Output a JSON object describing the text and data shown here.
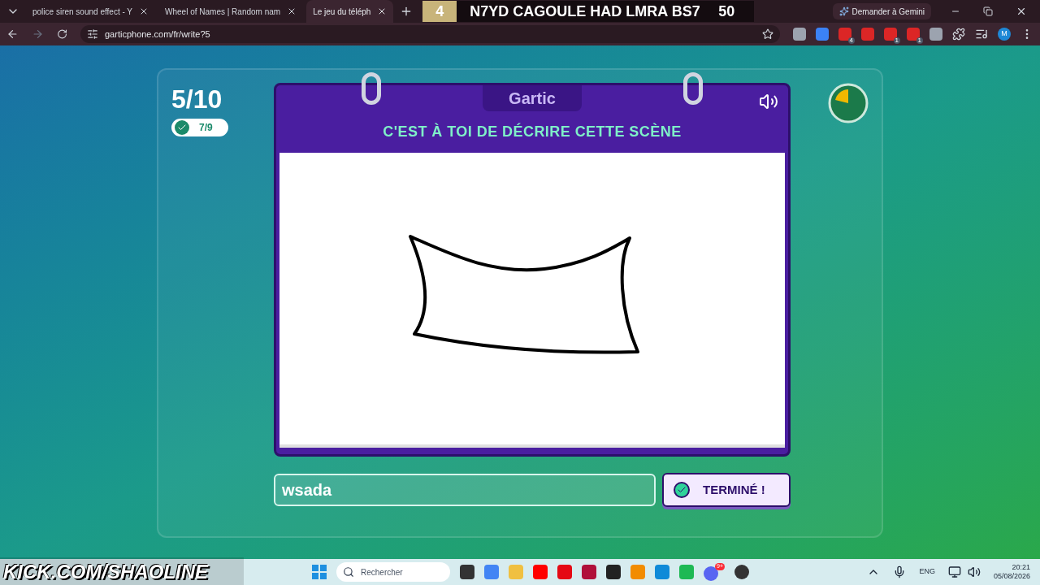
{
  "browser": {
    "tabs": [
      {
        "title": "police siren sound effect - Y",
        "selected": false
      },
      {
        "title": "Wheel of Names | Random nam",
        "selected": false
      },
      {
        "title": "Le jeu du téléph",
        "selected": true
      }
    ],
    "gemini_button": "Demander à Gemini",
    "url": "garticphone.com/fr/write?5",
    "extension_badges": [
      "4",
      "1",
      "1"
    ],
    "profile_initial": "M"
  },
  "stream_banner": {
    "number": "4",
    "title": "N7YD CAGOULE HAD LMRA BS7",
    "score": "50"
  },
  "game": {
    "round": "5/10",
    "players_done": "7/9",
    "logo": "Gartic",
    "instruction": "C'EST À TOI DE DÉCRIRE CETTE SCÈNE",
    "answer": "wsada",
    "done_button": "TERMINÉ !"
  },
  "kick_overlay": "KICK.COM/SHAOLINE",
  "taskbar": {
    "search_placeholder": "Rechercher",
    "discord_badge": "9+",
    "language": "ENG",
    "time": "20:21",
    "date": "05/08/2026"
  }
}
